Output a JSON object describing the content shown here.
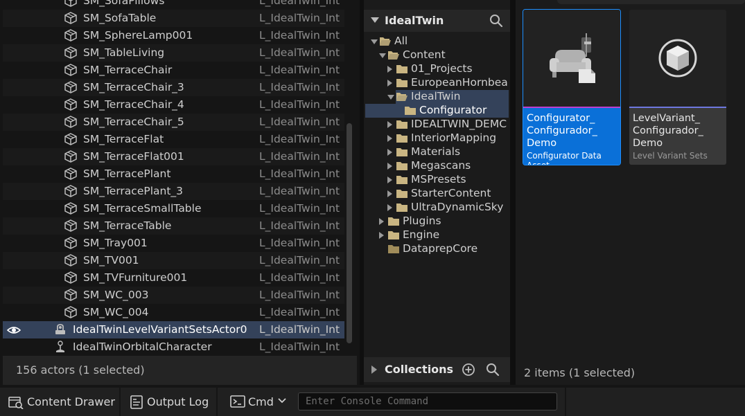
{
  "outliner": {
    "rows": [
      {
        "name": "SM_SofaPillows",
        "level": "L_IdealTwin_Int",
        "type": "mesh"
      },
      {
        "name": "SM_SofaTable",
        "level": "L_IdealTwin_Int",
        "type": "mesh"
      },
      {
        "name": "SM_SphereLamp001",
        "level": "L_IdealTwin_Int",
        "type": "mesh"
      },
      {
        "name": "SM_TableLiving",
        "level": "L_IdealTwin_Int",
        "type": "mesh"
      },
      {
        "name": "SM_TerraceChair",
        "level": "L_IdealTwin_Int",
        "type": "mesh"
      },
      {
        "name": "SM_TerraceChair_3",
        "level": "L_IdealTwin_Int",
        "type": "mesh"
      },
      {
        "name": "SM_TerraceChair_4",
        "level": "L_IdealTwin_Int",
        "type": "mesh"
      },
      {
        "name": "SM_TerraceChair_5",
        "level": "L_IdealTwin_Int",
        "type": "mesh"
      },
      {
        "name": "SM_TerraceFlat",
        "level": "L_IdealTwin_Int",
        "type": "mesh"
      },
      {
        "name": "SM_TerraceFlat001",
        "level": "L_IdealTwin_Int",
        "type": "mesh"
      },
      {
        "name": "SM_TerracePlant",
        "level": "L_IdealTwin_Int",
        "type": "mesh"
      },
      {
        "name": "SM_TerracePlant_3",
        "level": "L_IdealTwin_Int",
        "type": "mesh"
      },
      {
        "name": "SM_TerraceSmallTable",
        "level": "L_IdealTwin_Int",
        "type": "mesh"
      },
      {
        "name": "SM_TerraceTable",
        "level": "L_IdealTwin_Int",
        "type": "mesh"
      },
      {
        "name": "SM_Tray001",
        "level": "L_IdealTwin_Int",
        "type": "mesh"
      },
      {
        "name": "SM_TV001",
        "level": "L_IdealTwin_Int",
        "type": "mesh"
      },
      {
        "name": "SM_TVFurniture001",
        "level": "L_IdealTwin_Int",
        "type": "mesh"
      },
      {
        "name": "SM_WC_003",
        "level": "L_IdealTwin_Int",
        "type": "mesh"
      },
      {
        "name": "SM_WC_004",
        "level": "L_IdealTwin_Int",
        "type": "mesh"
      },
      {
        "name": "IdealTwinLevelVariantSetsActor0",
        "level": "L_IdealTwin_Int",
        "type": "variant",
        "selected": true
      },
      {
        "name": "IdealTwinOrbitalCharacter",
        "level": "L_IdealTwin_Int",
        "type": "character"
      }
    ],
    "footer": "156 actors (1 selected)"
  },
  "sources": {
    "title": "IdealTwin",
    "tree": [
      {
        "label": "All",
        "depth": 0,
        "toggle": "open"
      },
      {
        "label": "Content",
        "depth": 1,
        "toggle": "open"
      },
      {
        "label": "01_Projects",
        "depth": 2,
        "toggle": "closed"
      },
      {
        "label": "EuropeanHornbea",
        "depth": 2,
        "toggle": "closed"
      },
      {
        "label": "IdealTwin",
        "depth": 2,
        "toggle": "open",
        "highlight": "partial"
      },
      {
        "label": "Configurator",
        "depth": 3,
        "toggle": "none",
        "selected": true
      },
      {
        "label": "IDEALTWIN_DEMC",
        "depth": 2,
        "toggle": "closed"
      },
      {
        "label": "InteriorMapping",
        "depth": 2,
        "toggle": "closed"
      },
      {
        "label": "Materials",
        "depth": 2,
        "toggle": "closed"
      },
      {
        "label": "Megascans",
        "depth": 2,
        "toggle": "closed"
      },
      {
        "label": "MSPresets",
        "depth": 2,
        "toggle": "closed"
      },
      {
        "label": "StarterContent",
        "depth": 2,
        "toggle": "closed"
      },
      {
        "label": "UltraDynamicSky",
        "depth": 2,
        "toggle": "closed"
      },
      {
        "label": "Plugins",
        "depth": 1,
        "toggle": "closed"
      },
      {
        "label": "Engine",
        "depth": 1,
        "toggle": "closed"
      },
      {
        "label": "DataprepCore",
        "depth": 1,
        "toggle": "none"
      }
    ],
    "collections_title": "Collections"
  },
  "assets": {
    "items": [
      {
        "name": "Configurator_ Configurador_ Demo",
        "type": "Configurator Data Asset",
        "bar_color": "#c03fd0",
        "selected": true
      },
      {
        "name": "LevelVariant_ Configurador_ Demo",
        "type": "Level Variant Sets",
        "bar_color": "#6e78e0",
        "selected": false
      }
    ],
    "status": "2 items (1 selected)"
  },
  "statusbar": {
    "content_drawer": "Content Drawer",
    "output_log": "Output Log",
    "cmd": "Cmd",
    "console_placeholder": "Enter Console Command"
  }
}
